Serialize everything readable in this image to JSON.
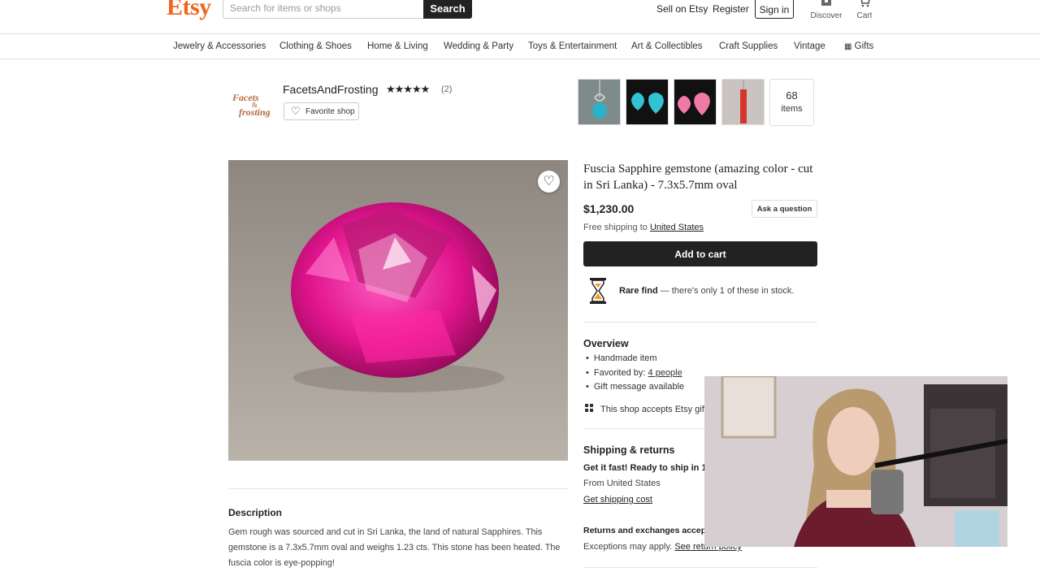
{
  "header": {
    "logo": "Etsy",
    "search_placeholder": "Search for items or shops",
    "search_button": "Search",
    "sell_on_etsy": "Sell on Etsy",
    "register": "Register",
    "sign_in": "Sign in",
    "discover": "Discover",
    "cart": "Cart"
  },
  "categories": [
    "Jewelry & Accessories",
    "Clothing & Shoes",
    "Home & Living",
    "Wedding & Party",
    "Toys & Entertainment",
    "Art & Collectibles",
    "Craft Supplies",
    "Vintage",
    "Gifts"
  ],
  "shop": {
    "logo_text": "Facets & Frosting",
    "name": "FacetsAndFrosting",
    "stars": "★★★★★",
    "rating": 5,
    "review_count": "(2)",
    "favorite_label": "Favorite shop",
    "items_count": "68",
    "items_label": "items"
  },
  "listing": {
    "title": "Fuscia Sapphire gemstone (amazing color - cut in Sri Lanka) - 7.3x5.7mm oval",
    "price": "$1,230.00",
    "ask_question": "Ask a question",
    "shipping_prefix": "Free shipping to",
    "shipping_country": "United States",
    "add_to_cart": "Add to cart",
    "rare_bold": "Rare find",
    "rare_text": " — there's only 1 of these in stock."
  },
  "overview": {
    "heading": "Overview",
    "items": [
      "Handmade item",
      "Favorited by:",
      "Gift message available"
    ],
    "favorited_link": "4 people",
    "gift_cards": "This shop accepts Etsy gift cards"
  },
  "shipping": {
    "heading": "Shipping & returns",
    "fast": "Get it fast! Ready to ship in 1–3 business days",
    "from": "From United States",
    "cost_link": "Get shipping cost",
    "returns_heading": "Returns and exchanges accepted",
    "exceptions": "Exceptions may apply.",
    "return_policy_link": "See return policy"
  },
  "description": {
    "heading": "Description",
    "text": "Gem rough was sourced and cut in Sri Lanka, the land of natural Sapphires. This gemstone is a 7.3x5.7mm oval and weighs 1.23 cts. This stone has been heated. The fuscia color is eye-popping!"
  },
  "icons": {
    "heart": "heart-icon",
    "gift": "gift-icon",
    "hourglass": "hourglass-icon",
    "cart": "cart-icon",
    "discover": "discover-icon"
  },
  "colors": {
    "brand": "#f1641e",
    "button_dark": "#222222",
    "gem": "#e0148c"
  }
}
